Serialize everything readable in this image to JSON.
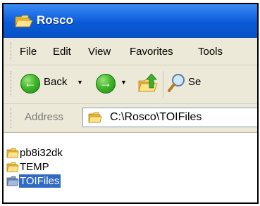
{
  "window": {
    "title": "Rosco"
  },
  "menu": {
    "items": [
      "File",
      "Edit",
      "View",
      "Favorites",
      "Tools"
    ]
  },
  "toolbar": {
    "back_label": "Back",
    "search_label": "Se"
  },
  "address": {
    "label": "Address",
    "value": "C:\\Rosco\\TOIFiles"
  },
  "files": [
    {
      "name": "pb8i32dk"
    },
    {
      "name": "TEMP"
    },
    {
      "name": "TOIFiles",
      "selected": true
    }
  ],
  "colors": {
    "titlebar": "#0a5bd8",
    "chrome": "#ece9d8",
    "selection": "#316ac5",
    "folder": "#f5c84a"
  }
}
